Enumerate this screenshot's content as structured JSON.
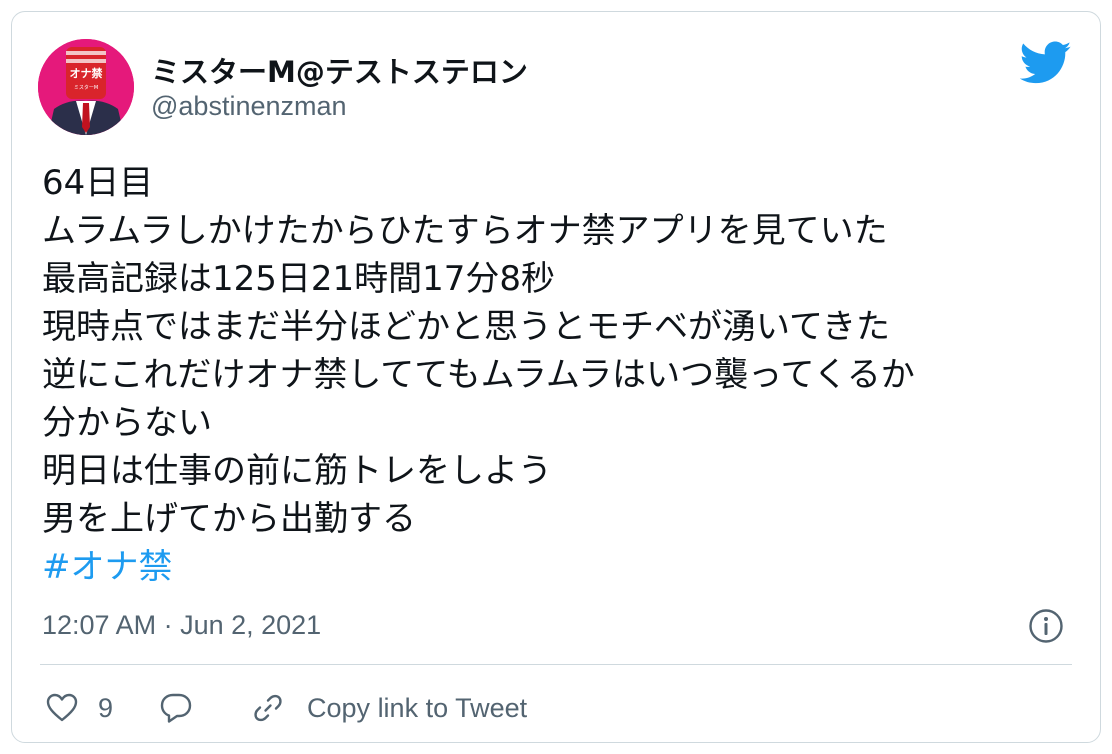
{
  "author": {
    "display_name": "ミスターM@テストステロン",
    "handle": "@abstinenzman",
    "avatar_text": "オナ禁",
    "avatar_subtext": "ミスターM"
  },
  "tweet": {
    "lines": [
      "64日目",
      "ムラムラしかけたからひたすらオナ禁アプリを見ていた",
      "最高記録は125日21時間17分8秒",
      "現時点ではまだ半分ほどかと思うとモチベが湧いてきた",
      "逆にこれだけオナ禁しててもムラムラはいつ襲ってくるか",
      "分からない",
      "明日は仕事の前に筋トレをしよう",
      "男を上げてから出勤する"
    ],
    "hashtag": "#オナ禁",
    "timestamp": "12:07 AM · Jun 2, 2021"
  },
  "actions": {
    "like_count": "9",
    "copy_link_label": "Copy link to Tweet"
  },
  "icons": {
    "brand": "twitter-bird-icon",
    "info": "info-icon",
    "like": "heart-icon",
    "reply": "speech-bubble-icon",
    "copy": "link-icon"
  },
  "colors": {
    "brand_blue": "#1d9bf0",
    "text_primary": "#0f1419",
    "text_secondary": "#536471",
    "border": "#cfd9de",
    "avatar_bg": "#e5197b"
  }
}
